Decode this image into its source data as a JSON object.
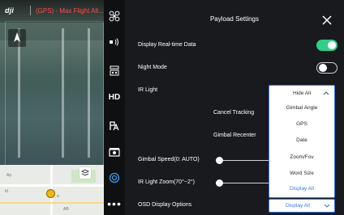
{
  "camera": {
    "logo": "dji",
    "status_text": "(GPS) - Max Flight Alt..."
  },
  "map": {
    "labels": [
      "Ap",
      "ld",
      "ic",
      "AB"
    ]
  },
  "rail": {
    "icons": [
      "drone-propeller-icon",
      "speaker-icon",
      "payload-icon",
      "hd-label",
      "ir-light-icon",
      "camera-icon",
      "target-icon",
      "more-icon"
    ],
    "hd_label": "HD",
    "more_label": "•••"
  },
  "panel": {
    "title": "Payload Settings",
    "rows": {
      "realtime": {
        "label": "Display Real-time Data",
        "enabled": true
      },
      "night": {
        "label": "Night Mode",
        "enabled": false
      },
      "ir": {
        "label": "IR Light"
      },
      "cancel_tracking": {
        "label": "Cancel Tracking"
      },
      "gimbal_recenter": {
        "label": "Gimbal Recenter"
      },
      "gimbal_speed": {
        "label": "Gimbal Speed(0: AUTO)",
        "value_fraction": 0.0
      },
      "ir_zoom": {
        "label": "IR Light Zoom(70°~2°)",
        "value_fraction": 0.0
      },
      "osd": {
        "label": "OSD Display Options"
      }
    }
  },
  "dropdown": {
    "options": [
      "Hide All",
      "Gimbal Angle",
      "GPS",
      "Date",
      "Zoom/Fov",
      "Word Size",
      "Display All"
    ],
    "selected": "Display All"
  },
  "osd_select": {
    "value": "Display All"
  },
  "colors": {
    "accent_green": "#2fd08a",
    "accent_blue": "#3b79e4",
    "status_red": "#ff4d4d"
  }
}
